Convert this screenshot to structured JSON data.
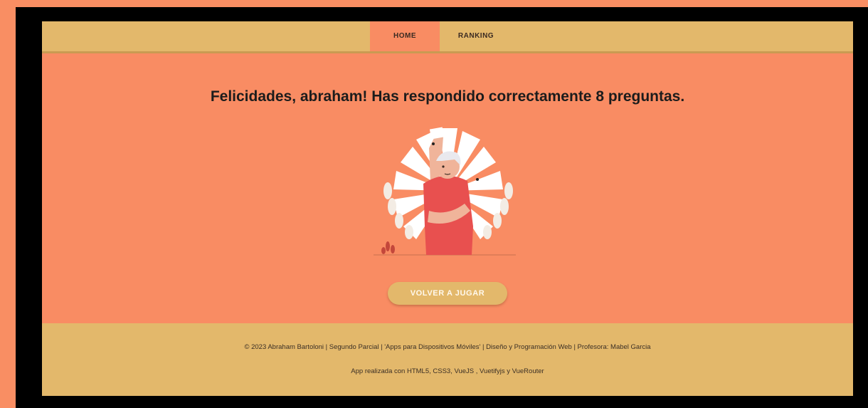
{
  "nav": {
    "items": [
      {
        "label": "HOME",
        "active": true
      },
      {
        "label": "RANKING",
        "active": false
      }
    ]
  },
  "main": {
    "message": "Felicidades, abraham! Has respondido correctamente 8 preguntas.",
    "illustration_icon": "celebrating-man-illustration",
    "play_again_label": "VOLVER A JUGAR"
  },
  "footer": {
    "line1": "© 2023 Abraham Bartoloni | Segundo Parcial | 'Apps para Dispositivos Móviles' | Diseño y Programación Web | Profesora: Mabel Garcia",
    "line2": "App realizada con HTML5, CSS3, VueJS , Vuetifyjs y VueRouter"
  },
  "colors": {
    "page_background": "#f98e63",
    "nav_background": "#e3b86b",
    "button_background": "#e3b86b",
    "illustration_shirt": "#e8504f"
  }
}
